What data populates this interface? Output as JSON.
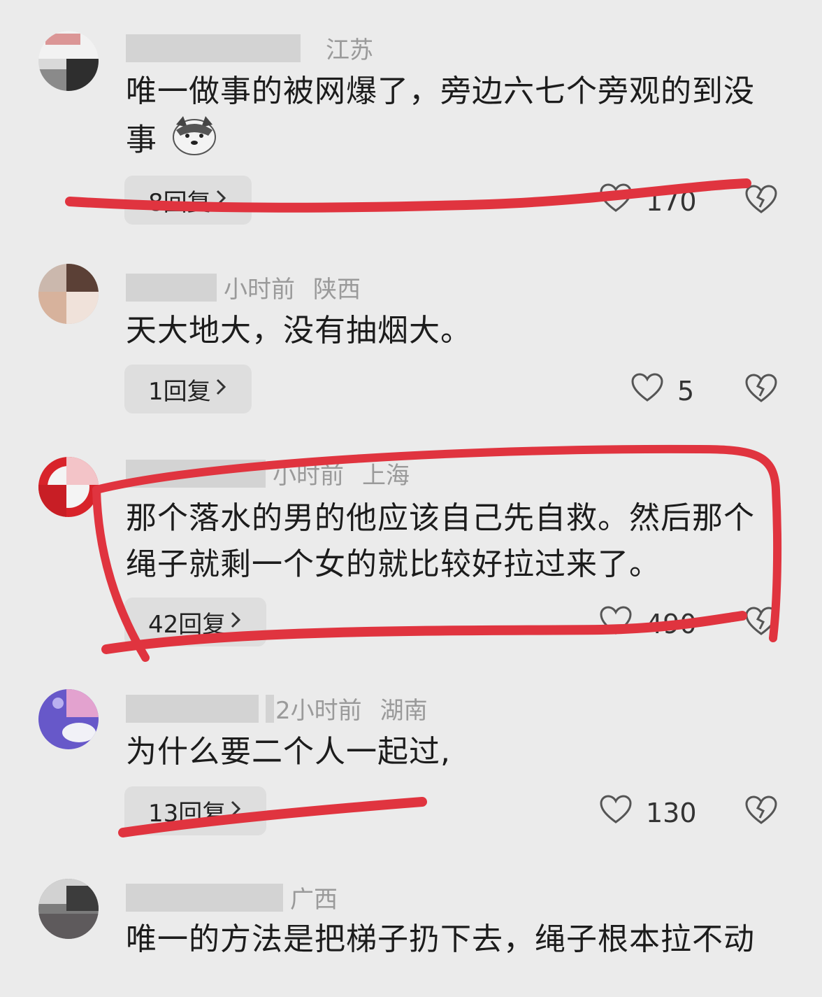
{
  "comments": [
    {
      "time": "",
      "location": "江苏",
      "text": "唯一做事的被网爆了，旁边六七个旁观的到没事",
      "emoji": "doge-emoji",
      "replies": "8回复",
      "likes": "170"
    },
    {
      "time": "小时前",
      "location": "陕西",
      "text": "天大地大，没有抽烟大。",
      "replies": "1回复",
      "likes": "5"
    },
    {
      "time": "小时前",
      "location": "上海",
      "text": "那个落水的男的他应该自己先自救。然后那个绳子就剩一个女的就比较好拉过来了。",
      "replies": "42回复",
      "likes": "490"
    },
    {
      "time": "2小时前",
      "location": "湖南",
      "text": "为什么要二个人一起过,",
      "replies": "13回复",
      "likes": "130"
    },
    {
      "time": "",
      "location": "广西",
      "text": "唯一的方法是把梯子扔下去，绳子根本拉不动"
    }
  ],
  "icons": {
    "chevron": "chevron-right-icon",
    "like": "heart-outline-icon",
    "dislike": "broken-heart-icon"
  },
  "colors": {
    "annotation": "#e0343f",
    "background": "#ebebeb"
  }
}
